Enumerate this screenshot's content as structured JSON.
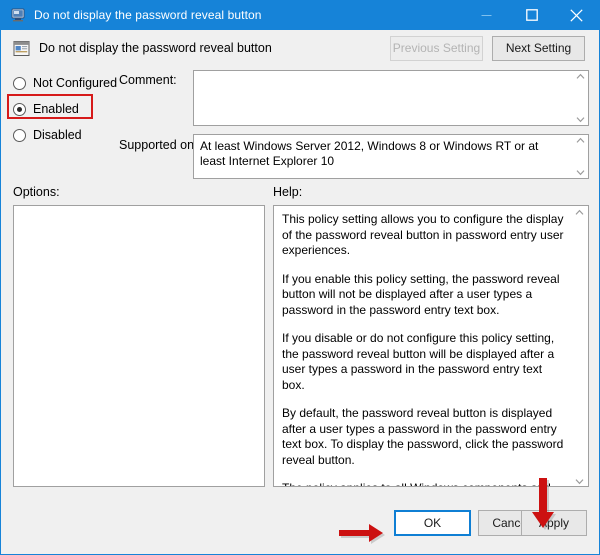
{
  "window": {
    "title": "Do not display the password reveal button",
    "icon": "policy-setting-icon",
    "minimize_label": "Minimize",
    "maximize_label": "Maximize",
    "close_label": "Close",
    "accent_color": "#1683d8"
  },
  "header": {
    "icon": "policy-document-icon",
    "title": "Do not display the password reveal button",
    "previous_setting": "Previous Setting",
    "next_setting": "Next Setting",
    "previous_enabled": false,
    "next_enabled": true
  },
  "state_options": {
    "not_configured": "Not Configured",
    "enabled": "Enabled",
    "disabled": "Disabled",
    "selected": "Enabled",
    "highlight_color": "#d61a1a"
  },
  "fields": {
    "comment_label": "Comment:",
    "comment_value": "",
    "supported_label": "Supported on:",
    "supported_value": "At least Windows Server 2012, Windows 8 or Windows RT or at least Internet Explorer 10"
  },
  "panels": {
    "options_label": "Options:",
    "options_value": "",
    "help_label": "Help:",
    "help_paragraphs": [
      "This policy setting allows you to configure the display of the password reveal button in password entry user experiences.",
      "If you enable this policy setting, the password reveal button will not be displayed after a user types a password in the password entry text box.",
      "If you disable or do not configure this policy setting, the password reveal button will be displayed after a user types a password in the password entry text box.",
      "By default, the password reveal button is displayed after a user types a password in the password entry text box. To display the password, click the password reveal button.",
      "The policy applies to all Windows components and applications that use the Windows system controls, including Internet Explorer."
    ]
  },
  "footer": {
    "ok": "OK",
    "cancel": "Cancel",
    "apply": "Apply",
    "focused_button": "OK",
    "focus_color": "#0f7fd4"
  },
  "annotations": {
    "arrow_to_ok": "red-right-arrow",
    "arrow_to_apply": "red-down-arrow",
    "arrow_color": "#cc1111"
  }
}
